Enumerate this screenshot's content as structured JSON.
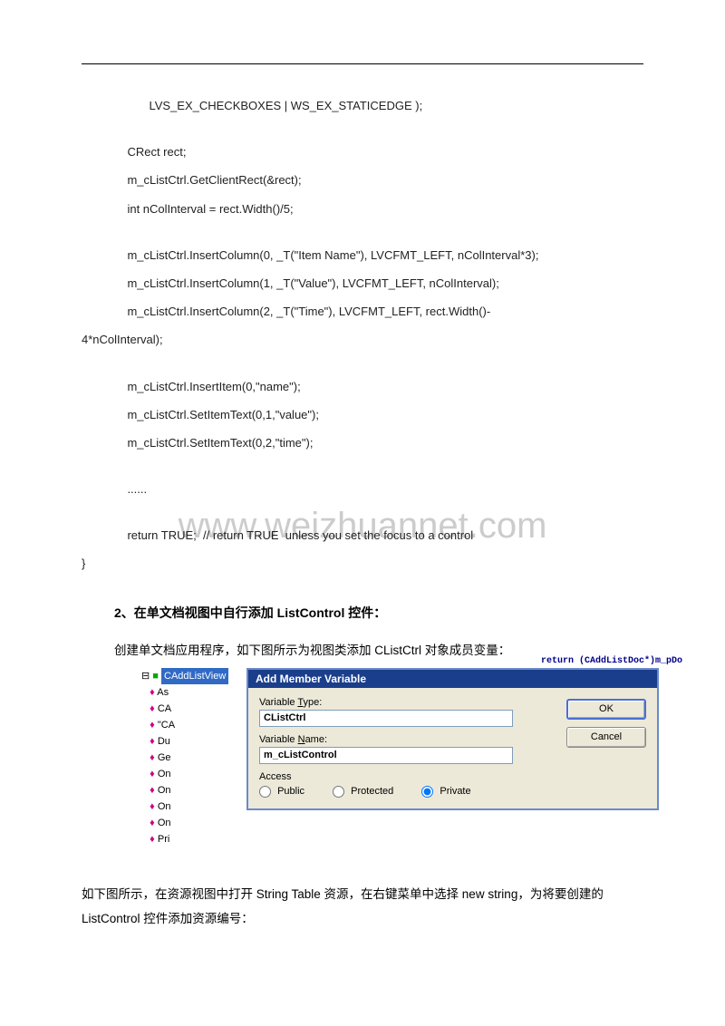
{
  "watermark": "www.weizhuannet.com",
  "code": {
    "line01": "    LVS_EX_CHECKBOXES | WS_EX_STATICEDGE );",
    "line02": "    CRect rect;",
    "line03": "    m_cListCtrl.GetClientRect(&rect);",
    "line04": "    int nColInterval = rect.Width()/5;",
    "line05": "    m_cListCtrl.InsertColumn(0, _T(\"Item Name\"), LVCFMT_LEFT, nColInterval*3);",
    "line06": "    m_cListCtrl.InsertColumn(1, _T(\"Value\"), LVCFMT_LEFT, nColInterval);",
    "line07": "    m_cListCtrl.InsertColumn(2, _T(\"Time\"), LVCFMT_LEFT, rect.Width()-",
    "line08": "4*nColInterval);",
    "line09": "    m_cListCtrl.InsertItem(0,\"name\");",
    "line10": "    m_cListCtrl.SetItemText(0,1,\"value\");",
    "line11": "    m_cListCtrl.SetItemText(0,2,\"time\");",
    "line12": "    ......",
    "line13": "    return TRUE;  // return TRUE  unless you set the focus to a control",
    "line14": "}"
  },
  "section2_heading": "2、在单文档视图中自行添加 ListControl 控件：",
  "para1": "创建单文档应用程序，如下图所示为视图类添加 CListCtrl 对象成员变量：",
  "para2": "    如下图所示，在资源视图中打开 String Table 资源，在右键菜单中选择 new string，为将要创建的 ListControl 控件添加资源编号：",
  "dialog": {
    "class_name": "CAddListView",
    "title": "Add Member Variable",
    "snippet": "return (CAddListDoc*)m_pDo",
    "var_type_label_pre": "Variable ",
    "var_type_label_u": "T",
    "var_type_label_post": "ype:",
    "var_type_value": "CListCtrl",
    "var_name_label_pre": "Variable ",
    "var_name_label_u": "N",
    "var_name_label_post": "ame:",
    "var_name_value": "m_cListControl",
    "access_label": "Access",
    "radio_public": "Public",
    "radio_protected": "Protected",
    "radio_private": "Private",
    "ok_btn": "OK",
    "cancel_btn": "Cancel",
    "tree": {
      "r0": "CAddListView",
      "r1": "As",
      "r2": "CA",
      "r3": "\"CA",
      "r4": "Du",
      "r5": "Ge",
      "r6": "On",
      "r7": "On",
      "r8": "On",
      "r9": "On",
      "r10": "Pri"
    }
  }
}
